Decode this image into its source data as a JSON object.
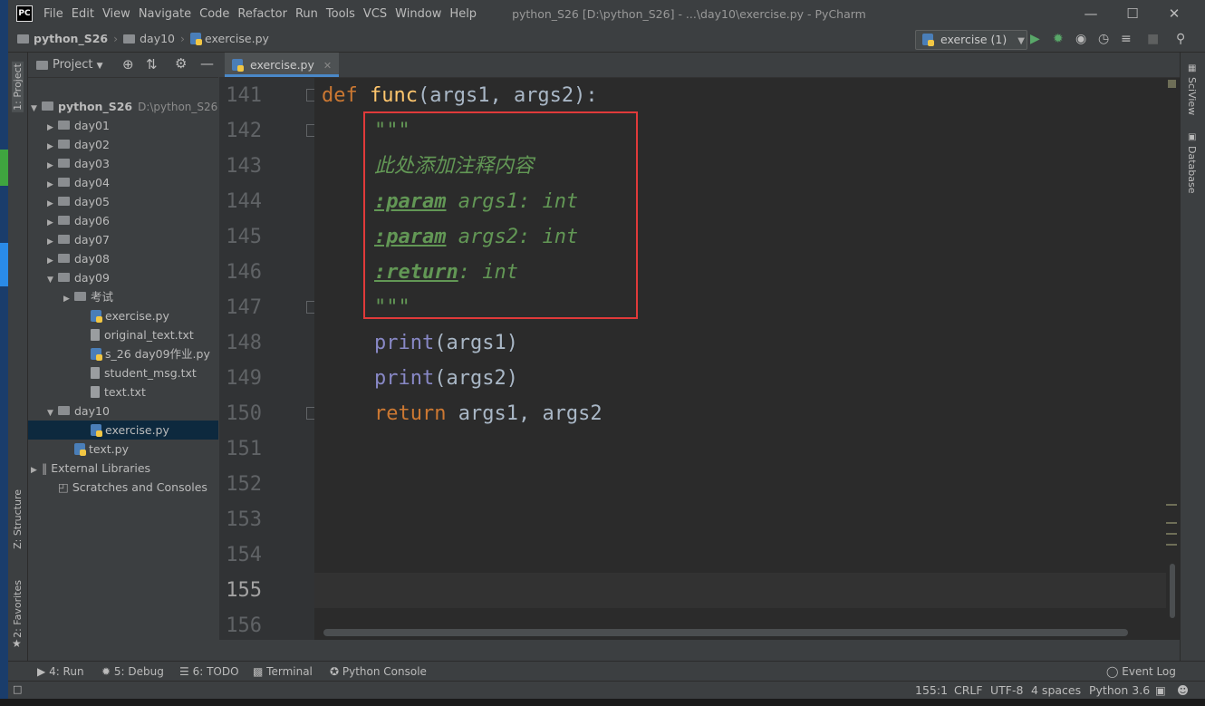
{
  "window": {
    "title": "python_S26 [D:\\python_S26] - ...\\day10\\exercise.py - PyCharm",
    "logo": "PC"
  },
  "menu": [
    "File",
    "Edit",
    "View",
    "Navigate",
    "Code",
    "Refactor",
    "Run",
    "Tools",
    "VCS",
    "Window",
    "Help"
  ],
  "breadcrumb": [
    "python_S26",
    "day10",
    "exercise.py"
  ],
  "run_config": "exercise (1)",
  "left_stripe": {
    "project": "1: Project",
    "structure": "Z: Structure",
    "favorites": "2: Favorites"
  },
  "right_stripe": {
    "sciview": "SciView",
    "database": "Database"
  },
  "project_panel": {
    "header": "Project",
    "tree": [
      {
        "label": "python_S26",
        "hint": "D:\\python_S26",
        "kind": "root",
        "arrow": "▼"
      },
      {
        "label": "day01",
        "kind": "folder",
        "arrow": "▶"
      },
      {
        "label": "day02",
        "kind": "folder",
        "arrow": "▶"
      },
      {
        "label": "day03",
        "kind": "folder",
        "arrow": "▶"
      },
      {
        "label": "day04",
        "kind": "folder",
        "arrow": "▶"
      },
      {
        "label": "day05",
        "kind": "folder",
        "arrow": "▶"
      },
      {
        "label": "day06",
        "kind": "folder",
        "arrow": "▶"
      },
      {
        "label": "day07",
        "kind": "folder",
        "arrow": "▶"
      },
      {
        "label": "day08",
        "kind": "folder",
        "arrow": "▶"
      },
      {
        "label": "day09",
        "kind": "folder",
        "arrow": "▼"
      },
      {
        "label": "考试",
        "kind": "folder",
        "arrow": "▶"
      },
      {
        "label": "exercise.py",
        "kind": "py"
      },
      {
        "label": "original_text.txt",
        "kind": "file"
      },
      {
        "label": "s_26 day09作业.py",
        "kind": "py"
      },
      {
        "label": "student_msg.txt",
        "kind": "file"
      },
      {
        "label": "text.txt",
        "kind": "file"
      },
      {
        "label": "day10",
        "kind": "folder",
        "arrow": "▼"
      },
      {
        "label": "exercise.py",
        "kind": "py",
        "selected": true
      },
      {
        "label": "text.py",
        "kind": "py"
      },
      {
        "label": "External Libraries",
        "kind": "lib",
        "arrow": "▶"
      },
      {
        "label": "Scratches and Consoles",
        "kind": "scratch"
      }
    ]
  },
  "editor": {
    "tab": "exercise.py",
    "line_numbers": [
      "141",
      "142",
      "143",
      "144",
      "145",
      "146",
      "147",
      "148",
      "149",
      "150",
      "151",
      "152",
      "153",
      "154",
      "155",
      "156"
    ],
    "current_line": "155",
    "code": {
      "l141": {
        "kw": "def",
        "fn": "func",
        "rest": "(args1, args2):"
      },
      "l142": "\"\"\"",
      "l143": "此处添加注释内容",
      "l144": {
        "tag": ":param",
        "rest": " args1: int"
      },
      "l145": {
        "tag": ":param",
        "rest": " args2: int"
      },
      "l146": {
        "tag": ":return",
        "rest": ": int"
      },
      "l147": "\"\"\"",
      "l148": {
        "bi": "print",
        "rest": "(args1)"
      },
      "l149": {
        "bi": "print",
        "rest": "(args2)"
      },
      "l150": {
        "kw": "return",
        "rest": " args1, args2"
      }
    }
  },
  "bottom_tools": {
    "run": "4: Run",
    "debug": "5: Debug",
    "todo": "6: TODO",
    "terminal": "Terminal",
    "console": "Python Console",
    "event_log": "Event Log"
  },
  "status": {
    "position": "155:1",
    "line_sep": "CRLF",
    "encoding": "UTF-8",
    "indent": "4 spaces",
    "interpreter": "Python 3.6"
  },
  "colors": {
    "accent": "#4a88c7",
    "highlight_box": "#e03a3a",
    "keyword": "#cc7832",
    "docstring": "#629755"
  }
}
